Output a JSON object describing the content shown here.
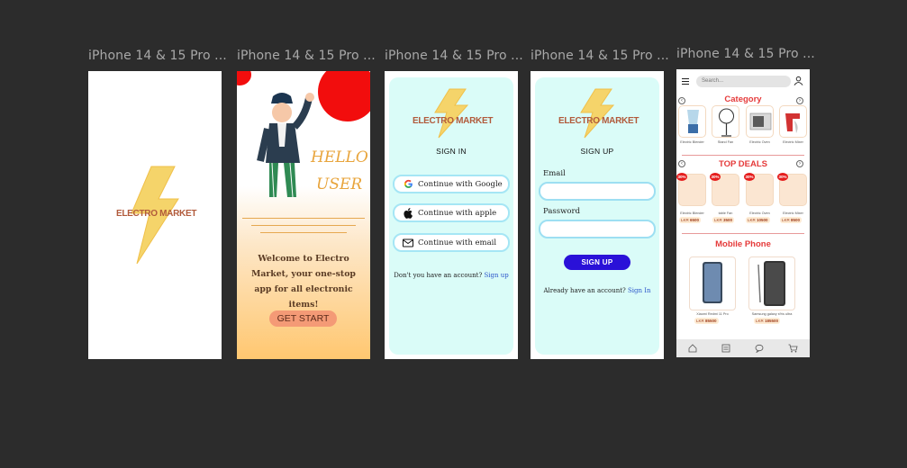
{
  "frames": [
    {
      "title": "iPhone 14 & 15 Pro ..."
    },
    {
      "title": "iPhone 14 & 15 Pro ..."
    },
    {
      "title": "iPhone 14 & 15 Pro ..."
    },
    {
      "title": "iPhone 14 & 15 Pro ..."
    },
    {
      "title": "iPhone 14 & 15 Pro ..."
    }
  ],
  "brand": {
    "logo_text": "ELECTRO MARKET"
  },
  "intro": {
    "hello": "HELLO",
    "user": "USER",
    "welcome": "Welcome to Electro Market, your one-stop app for all electronic items!",
    "cta": "GET START"
  },
  "signin": {
    "title": "SIGN IN",
    "google": "Continue with Google",
    "apple": "Continue with apple",
    "email": "Continue with email",
    "footer_text": "Don't you have an account?",
    "footer_link": "Sign up"
  },
  "signup": {
    "title": "SIGN UP",
    "email_label": "Email",
    "password_label": "Password",
    "button": "SIGN UP",
    "footer_text": "Already have an account?",
    "footer_link": "Sign In"
  },
  "home": {
    "search_placeholder": "Search...",
    "category_title": "Category",
    "categories": [
      "Electric Blender",
      "Stand Fan",
      "Electric Oven",
      "Electric Mixer"
    ],
    "deals_title": "TOP DEALS",
    "deals": [
      {
        "name": "Electric Blender",
        "currency": "LKR",
        "price": "6500",
        "badge": "30%"
      },
      {
        "name": "table Fan",
        "currency": "LKR",
        "price": "3500",
        "badge": "30%"
      },
      {
        "name": "Electric Oven",
        "currency": "LKR",
        "price": "10500",
        "badge": "30%"
      },
      {
        "name": "Electric Mixer",
        "currency": "LKR",
        "price": "8500",
        "badge": "30%"
      }
    ],
    "mobile_title": "Mobile Phone",
    "phones": [
      {
        "name": "Xiaomi Redmi 11 Pro",
        "currency": "LKR",
        "price": "85500"
      },
      {
        "name": "Samsung galaxy s%s ultra",
        "currency": "LKR",
        "price": "185500"
      }
    ]
  },
  "colors": {
    "accent_red": "#e53a3a",
    "bolt": "#f4cf63",
    "signup_button": "#2a11d8",
    "auth_bg": "#dafcf8"
  }
}
